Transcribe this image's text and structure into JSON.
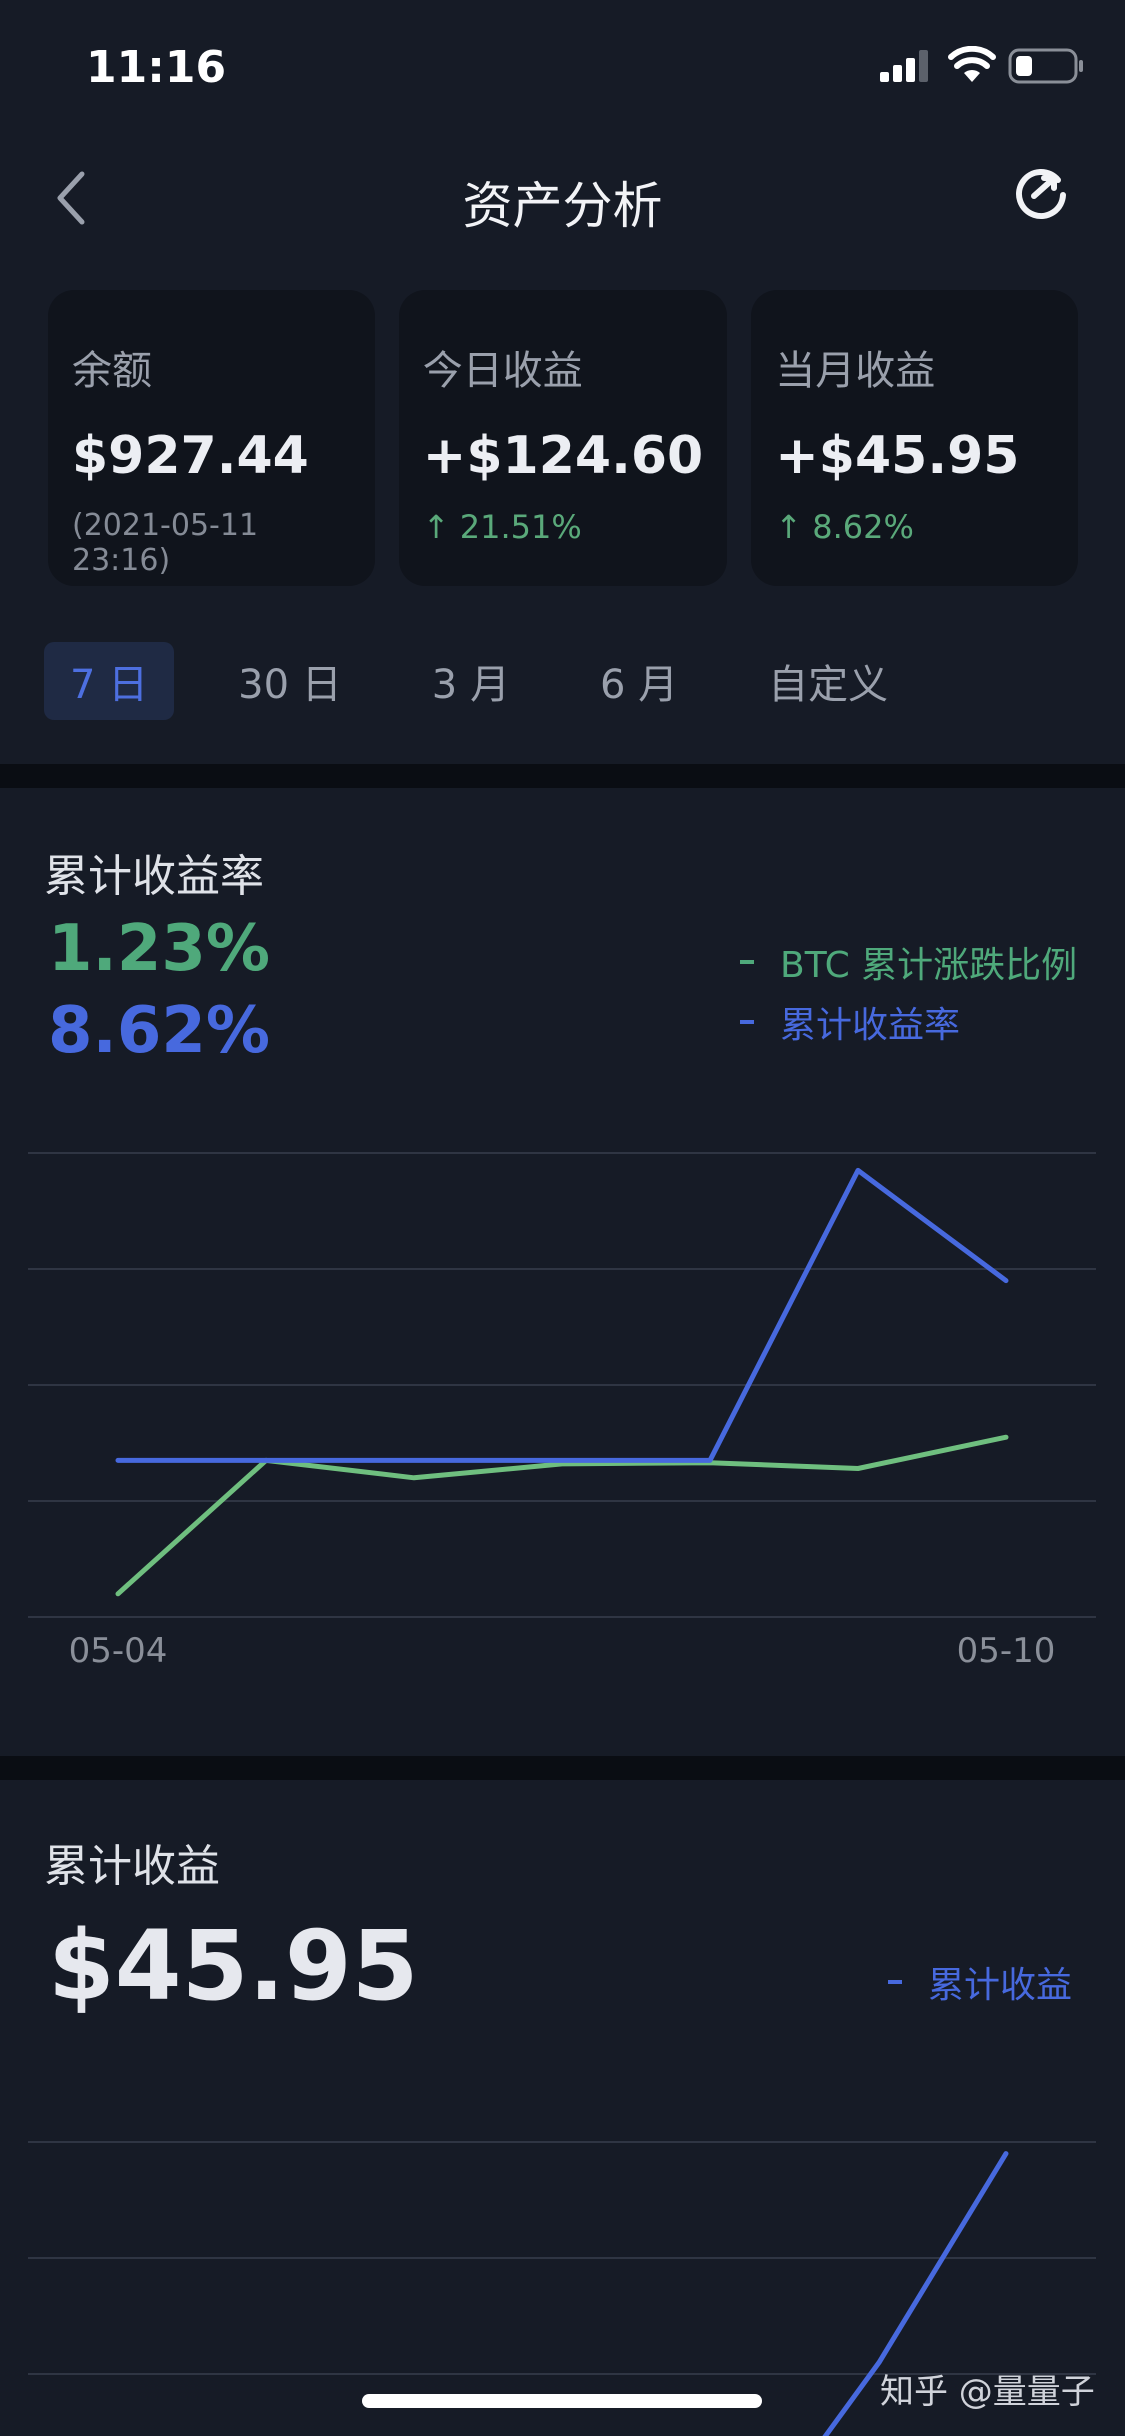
{
  "status": {
    "time": "11:16"
  },
  "nav": {
    "title": "资产分析"
  },
  "cards": [
    {
      "label": "余额",
      "value": "$927.44",
      "sub": "(2021-05-11 23:16)"
    },
    {
      "label": "今日收益",
      "value": "+$124.60",
      "change": "↑ 21.51%"
    },
    {
      "label": "当月收益",
      "value": "+$45.95",
      "change": "↑ 8.62%"
    }
  ],
  "tabs": [
    {
      "label": "7 日",
      "active": true
    },
    {
      "label": "30 日",
      "active": false
    },
    {
      "label": "3 月",
      "active": false
    },
    {
      "label": "6 月",
      "active": false
    },
    {
      "label": "自定义",
      "active": false
    }
  ],
  "section1": {
    "title": "累计收益率",
    "green_value": "1.23%",
    "blue_value": "8.62%",
    "legend": [
      {
        "label": "BTC 累计涨跌比例",
        "color": "#4fa97b"
      },
      {
        "label": "累计收益率",
        "color": "#4769de"
      }
    ]
  },
  "section2": {
    "title": "累计收益",
    "amount": "$45.95",
    "legend": [
      {
        "label": "累计收益",
        "color": "#4769de"
      }
    ]
  },
  "chart_data": [
    {
      "type": "line",
      "title": "累计收益率",
      "x_labels": [
        "05-04",
        "05-10"
      ],
      "grid": true,
      "ylim": [
        0,
        4
      ],
      "series": [
        {
          "name": "BTC 累计涨跌比例",
          "color": "#6fbf7f",
          "values": [
            0.2,
            1.35,
            1.2,
            1.32,
            1.33,
            1.28,
            1.55
          ]
        },
        {
          "name": "累计收益率",
          "color": "#4769de",
          "values": [
            1.35,
            1.35,
            1.35,
            1.35,
            1.35,
            3.85,
            2.9
          ]
        }
      ]
    },
    {
      "type": "line",
      "title": "累计收益",
      "grid": true,
      "ylim": [
        0,
        3
      ],
      "series": [
        {
          "name": "累计收益",
          "color": "#4769de",
          "values": [
            null,
            null,
            null,
            null,
            null,
            -0.4,
            1.1,
            2.9
          ]
        }
      ]
    }
  ],
  "watermark": "知乎 @量量子",
  "colors": {
    "background": "#161b26",
    "card": "#10141c",
    "accent_blue": "#4769de",
    "accent_green": "#4fa97b"
  }
}
